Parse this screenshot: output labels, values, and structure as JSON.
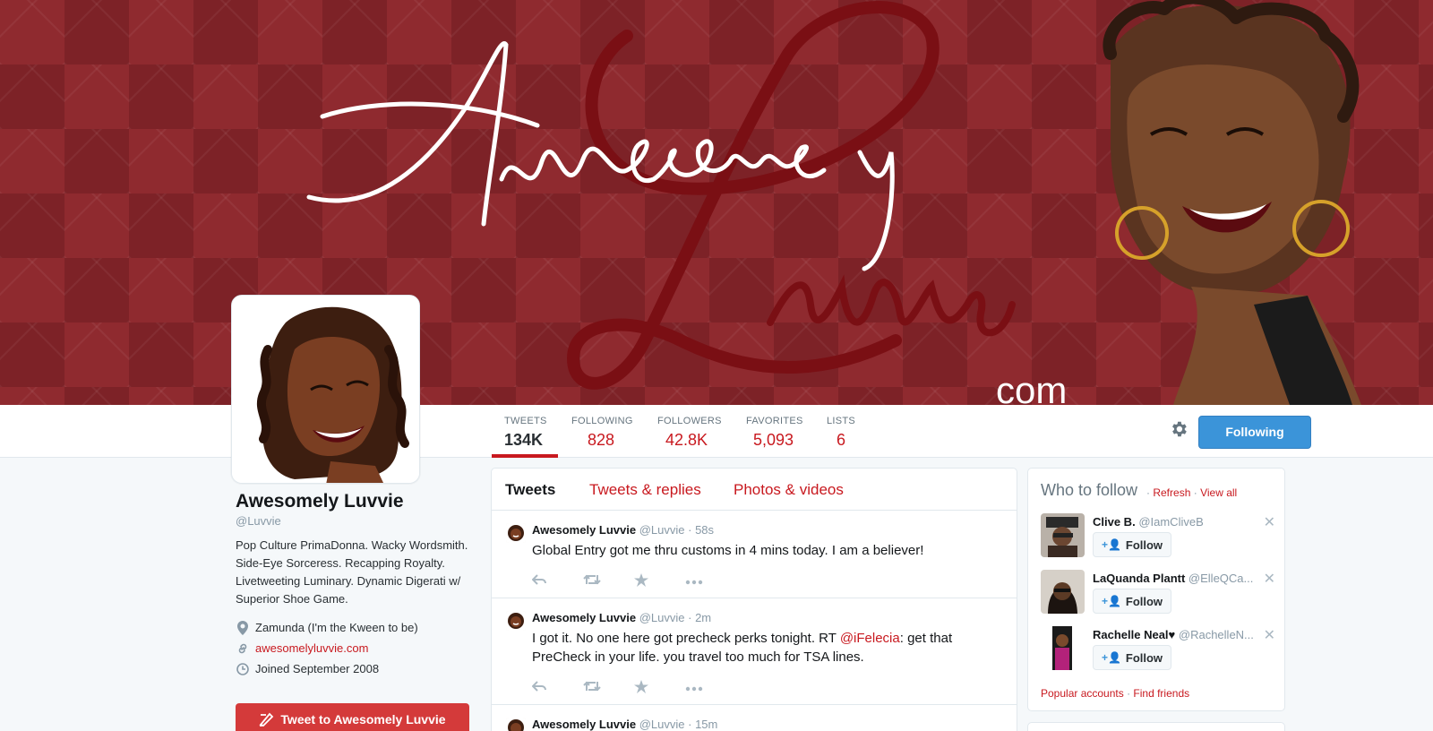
{
  "banner": {
    "script_text": "AwesomeLy Luvvie",
    "com_text": "com",
    "colors": {
      "background": "#8f2a2f",
      "accent": "#c8191f",
      "link_blue": "#3b94d9"
    }
  },
  "stats": [
    {
      "label": "TWEETS",
      "value": "134K"
    },
    {
      "label": "FOLLOWING",
      "value": "828"
    },
    {
      "label": "FOLLOWERS",
      "value": "42.8K"
    },
    {
      "label": "FAVORITES",
      "value": "5,093"
    },
    {
      "label": "LISTS",
      "value": "6"
    }
  ],
  "actions": {
    "follow_button_label": "Following",
    "gear_icon": "gear-icon"
  },
  "profile": {
    "name": "Awesomely Luvvie",
    "handle": "@Luvvie",
    "bio": "Pop Culture PrimaDonna. Wacky Wordsmith. Side-Eye Sorceress. Recapping Royalty. Livetweeting Luminary. Dynamic Digerati w/ Superior Shoe Game.",
    "location": "Zamunda (I'm the Kween to be)",
    "website": "awesomelyluvvie.com",
    "joined": "Joined September 2008",
    "tweet_to_label": "Tweet to Awesomely Luvvie"
  },
  "timeline": {
    "tabs": [
      "Tweets",
      "Tweets & replies",
      "Photos & videos"
    ],
    "tweets": [
      {
        "name": "Awesomely Luvvie",
        "handle": "@Luvvie",
        "time": "· 58s",
        "text": "Global Entry got me thru customs in 4 mins today. I am a believer!"
      },
      {
        "name": "Awesomely Luvvie",
        "handle": "@Luvvie",
        "time": "· 2m",
        "text_before": "I got it. No one here got precheck perks tonight. RT ",
        "mention": "@iFelecia",
        "text_after": ": get that PreCheck in your life. you travel too much for TSA lines."
      },
      {
        "name": "Awesomely Luvvie",
        "handle": "@Luvvie",
        "time": "· 15m"
      }
    ]
  },
  "who_to_follow": {
    "title": "Who to follow",
    "refresh": "Refresh",
    "separator": "·",
    "view_all": "View all",
    "follow_label": "Follow",
    "suggestions": [
      {
        "name": "Clive B.",
        "handle": "@IamCliveB"
      },
      {
        "name": "LaQuanda Plantt",
        "handle": "@ElleQCa..."
      },
      {
        "name": "Rachelle Neal♥",
        "handle": "@RachelleN..."
      }
    ],
    "popular": "Popular accounts",
    "find_friends": "Find friends"
  }
}
